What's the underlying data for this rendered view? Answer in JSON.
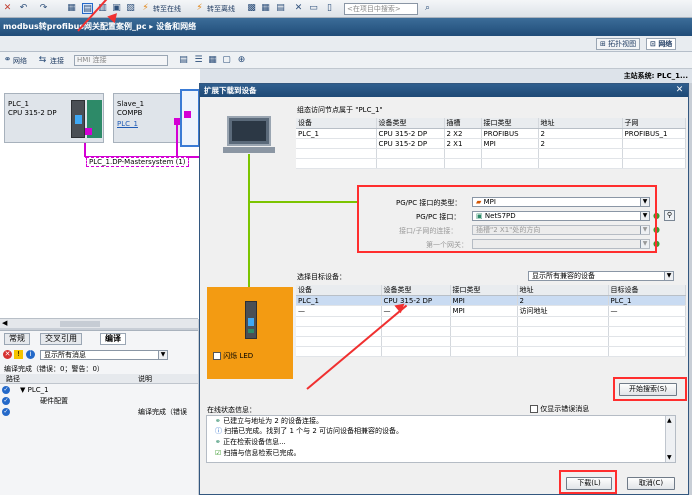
{
  "toolbar": {
    "go_online": "转至在线",
    "go_offline": "转至离线",
    "search_placeholder": "<在项目中搜索>"
  },
  "breadcrumb": "modbus转profibus网关配置案例_pc ▸ 设备和网络",
  "view_tabs": {
    "topology": "拓扑视图",
    "network": "网络"
  },
  "net_toolbar": {
    "network": "网络",
    "connections": "连接",
    "hmi_select": "HMI 连接"
  },
  "canvas": {
    "plc_name": "PLC_1",
    "plc_type": "CPU 315-2 DP",
    "slave_name": "Slave_1",
    "slave_type": "COMPB",
    "slave_link": "PLC_1",
    "network_label": "PLC_1.DP-Mastersystem (1)"
  },
  "main_system": "主站系统: PLC_1...",
  "dialog": {
    "title": "扩展下载到设备",
    "config_label": "组态访问节点属于 \"PLC_1\"",
    "config_headers": [
      "设备",
      "设备类型",
      "插槽",
      "接口类型",
      "地址",
      "子网"
    ],
    "config_rows": [
      [
        "PLC_1",
        "CPU 315-2 DP",
        "2 X2",
        "PROFIBUS",
        "2",
        "PROFIBUS_1"
      ],
      [
        "",
        "CPU 315-2 DP",
        "2 X1",
        "MPI",
        "2",
        ""
      ]
    ],
    "pgpc_type_label": "PG/PC 接口的类型：",
    "pgpc_type_value": "MPI",
    "pgpc_iface_label": "PG/PC 接口：",
    "pgpc_iface_value": "NetS7PD",
    "subnet_conn_label": "接口/子网的连接：",
    "subnet_conn_value": "插槽\"2 X1\"处的方向",
    "first_gateway_label": "第一个网关：",
    "target_label": "选择目标设备：",
    "target_filter": "显示所有兼容的设备",
    "target_headers": [
      "设备",
      "设备类型",
      "接口类型",
      "地址",
      "目标设备"
    ],
    "target_rows": [
      [
        "PLC_1",
        "CPU 315-2 DP",
        "MPI",
        "2",
        "PLC_1"
      ],
      [
        "—",
        "—",
        "MPI",
        "访问地址",
        "—"
      ]
    ],
    "flash_led": "闪烁 LED",
    "start_search": "开始搜索(S)",
    "status_label": "在线状态信息：",
    "only_errors": "仅显示错误消息",
    "log": [
      "已建立与地址为 2 的设备连接。",
      "扫描已完成。找到了 1 个与 2 可访问设备相兼容的设备。",
      "正在检索设备信息...",
      "扫描与信息检索已完成。"
    ],
    "download": "下载(L)",
    "cancel": "取消(C)"
  },
  "inspector": {
    "tabs": [
      "常规",
      "交叉引用",
      "编译"
    ],
    "filter": "显示所有消息",
    "summary": "编译完成（错误：0；警告：0）",
    "col_path": "路径",
    "col_desc": "说明",
    "rows": [
      {
        "path": "▼ PLC_1",
        "desc": ""
      },
      {
        "path": "硬件配置",
        "desc": ""
      },
      {
        "path": "",
        "desc": "编译完成（错误"
      }
    ]
  }
}
